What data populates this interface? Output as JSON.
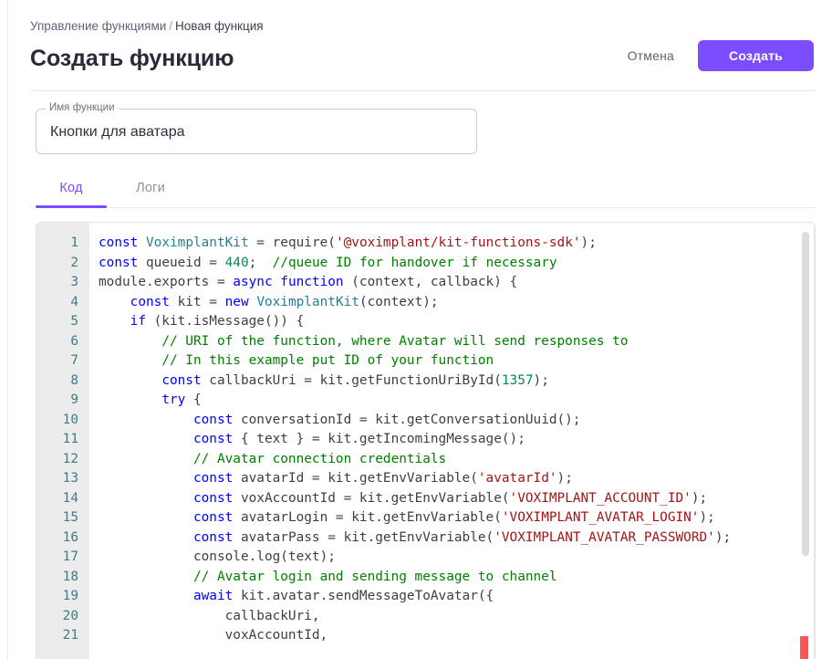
{
  "window": {
    "background": "#ffffff"
  },
  "header": {
    "breadcrumb": {
      "parent": "Управление функциями",
      "separator": "/",
      "current": "Новая функция"
    },
    "title": "Создать функцию",
    "cancel_label": "Отмена",
    "create_label": "Создать",
    "accent_color": "#7b4dff"
  },
  "name_field": {
    "label": "Имя функции",
    "value": "Кнопки для аватара",
    "placeholder": "Имя функции"
  },
  "tabs": {
    "active_index": 0,
    "items": [
      {
        "label": "Код"
      },
      {
        "label": "Логи"
      }
    ]
  },
  "editor": {
    "language": "javascript",
    "scrollbar": {
      "visible": true,
      "thumb_color": "#dcdcdc"
    },
    "error_marker": {
      "visible": true,
      "color": "#ff5555"
    },
    "theme": {
      "keyword": "#0000ff",
      "class": "#267f99",
      "string": "#a31515",
      "number": "#098658",
      "comment": "#008000",
      "plain": "#3b3f45",
      "gutter_bg": "#ececec",
      "line_number": "#3b7e87"
    },
    "lines": [
      {
        "n": "1",
        "tokens": [
          {
            "t": "kw",
            "s": "const"
          },
          {
            "t": "pln",
            "s": " "
          },
          {
            "t": "cls",
            "s": "VoximplantKit"
          },
          {
            "t": "pln",
            "s": " = require("
          },
          {
            "t": "str",
            "s": "'@voximplant/kit-functions-sdk'"
          },
          {
            "t": "pln",
            "s": ");"
          }
        ]
      },
      {
        "n": "2",
        "tokens": [
          {
            "t": "kw",
            "s": "const"
          },
          {
            "t": "pln",
            "s": " queueid = "
          },
          {
            "t": "num",
            "s": "440"
          },
          {
            "t": "pln",
            "s": ";  "
          },
          {
            "t": "com",
            "s": "//queue ID for handover if necessary"
          }
        ]
      },
      {
        "n": "3",
        "tokens": [
          {
            "t": "pln",
            "s": "module.exports = "
          },
          {
            "t": "kw",
            "s": "async function"
          },
          {
            "t": "pln",
            "s": " (context, callback) {"
          }
        ]
      },
      {
        "n": "4",
        "tokens": [
          {
            "t": "pln",
            "s": "    "
          },
          {
            "t": "kw",
            "s": "const"
          },
          {
            "t": "pln",
            "s": " kit = "
          },
          {
            "t": "kw",
            "s": "new"
          },
          {
            "t": "pln",
            "s": " "
          },
          {
            "t": "cls",
            "s": "VoximplantKit"
          },
          {
            "t": "pln",
            "s": "(context);"
          }
        ]
      },
      {
        "n": "5",
        "tokens": [
          {
            "t": "pln",
            "s": "    "
          },
          {
            "t": "kw",
            "s": "if"
          },
          {
            "t": "pln",
            "s": " (kit.isMessage()) {"
          }
        ]
      },
      {
        "n": "6",
        "tokens": [
          {
            "t": "pln",
            "s": "        "
          },
          {
            "t": "com",
            "s": "// URI of the function, where Avatar will send responses to"
          }
        ]
      },
      {
        "n": "7",
        "tokens": [
          {
            "t": "pln",
            "s": "        "
          },
          {
            "t": "com",
            "s": "// In this example put ID of your function"
          }
        ]
      },
      {
        "n": "8",
        "tokens": [
          {
            "t": "pln",
            "s": "        "
          },
          {
            "t": "kw",
            "s": "const"
          },
          {
            "t": "pln",
            "s": " callbackUri = kit.getFunctionUriById("
          },
          {
            "t": "num",
            "s": "1357"
          },
          {
            "t": "pln",
            "s": ");"
          }
        ]
      },
      {
        "n": "9",
        "tokens": [
          {
            "t": "pln",
            "s": "        "
          },
          {
            "t": "kw",
            "s": "try"
          },
          {
            "t": "pln",
            "s": " {"
          }
        ]
      },
      {
        "n": "10",
        "tokens": [
          {
            "t": "pln",
            "s": "            "
          },
          {
            "t": "kw",
            "s": "const"
          },
          {
            "t": "pln",
            "s": " conversationId = kit.getConversationUuid();"
          }
        ]
      },
      {
        "n": "11",
        "tokens": [
          {
            "t": "pln",
            "s": "            "
          },
          {
            "t": "kw",
            "s": "const"
          },
          {
            "t": "pln",
            "s": " { text } = kit.getIncomingMessage();"
          }
        ]
      },
      {
        "n": "12",
        "tokens": [
          {
            "t": "pln",
            "s": "            "
          },
          {
            "t": "com",
            "s": "// Avatar connection credentials"
          }
        ]
      },
      {
        "n": "13",
        "tokens": [
          {
            "t": "pln",
            "s": "            "
          },
          {
            "t": "kw",
            "s": "const"
          },
          {
            "t": "pln",
            "s": " avatarId = kit.getEnvVariable("
          },
          {
            "t": "str",
            "s": "'avatarId'"
          },
          {
            "t": "pln",
            "s": ");"
          }
        ]
      },
      {
        "n": "14",
        "tokens": [
          {
            "t": "pln",
            "s": "            "
          },
          {
            "t": "kw",
            "s": "const"
          },
          {
            "t": "pln",
            "s": " voxAccountId = kit.getEnvVariable("
          },
          {
            "t": "str",
            "s": "'VOXIMPLANT_ACCOUNT_ID'"
          },
          {
            "t": "pln",
            "s": ");"
          }
        ]
      },
      {
        "n": "15",
        "tokens": [
          {
            "t": "pln",
            "s": "            "
          },
          {
            "t": "kw",
            "s": "const"
          },
          {
            "t": "pln",
            "s": " avatarLogin = kit.getEnvVariable("
          },
          {
            "t": "str",
            "s": "'VOXIMPLANT_AVATAR_LOGIN'"
          },
          {
            "t": "pln",
            "s": ");"
          }
        ]
      },
      {
        "n": "16",
        "tokens": [
          {
            "t": "pln",
            "s": "            "
          },
          {
            "t": "kw",
            "s": "const"
          },
          {
            "t": "pln",
            "s": " avatarPass = kit.getEnvVariable("
          },
          {
            "t": "str",
            "s": "'VOXIMPLANT_AVATAR_PASSWORD'"
          },
          {
            "t": "pln",
            "s": ");"
          }
        ]
      },
      {
        "n": "17",
        "tokens": [
          {
            "t": "pln",
            "s": "            console.log(text);"
          }
        ]
      },
      {
        "n": "18",
        "tokens": [
          {
            "t": "pln",
            "s": "            "
          },
          {
            "t": "com",
            "s": "// Avatar login and sending message to channel"
          }
        ]
      },
      {
        "n": "19",
        "tokens": [
          {
            "t": "pln",
            "s": "            "
          },
          {
            "t": "kw",
            "s": "await"
          },
          {
            "t": "pln",
            "s": " kit.avatar.sendMessageToAvatar({"
          }
        ]
      },
      {
        "n": "20",
        "tokens": [
          {
            "t": "pln",
            "s": "                callbackUri,"
          }
        ]
      },
      {
        "n": "21",
        "tokens": [
          {
            "t": "pln",
            "s": "                voxAccountId,"
          }
        ]
      }
    ]
  }
}
